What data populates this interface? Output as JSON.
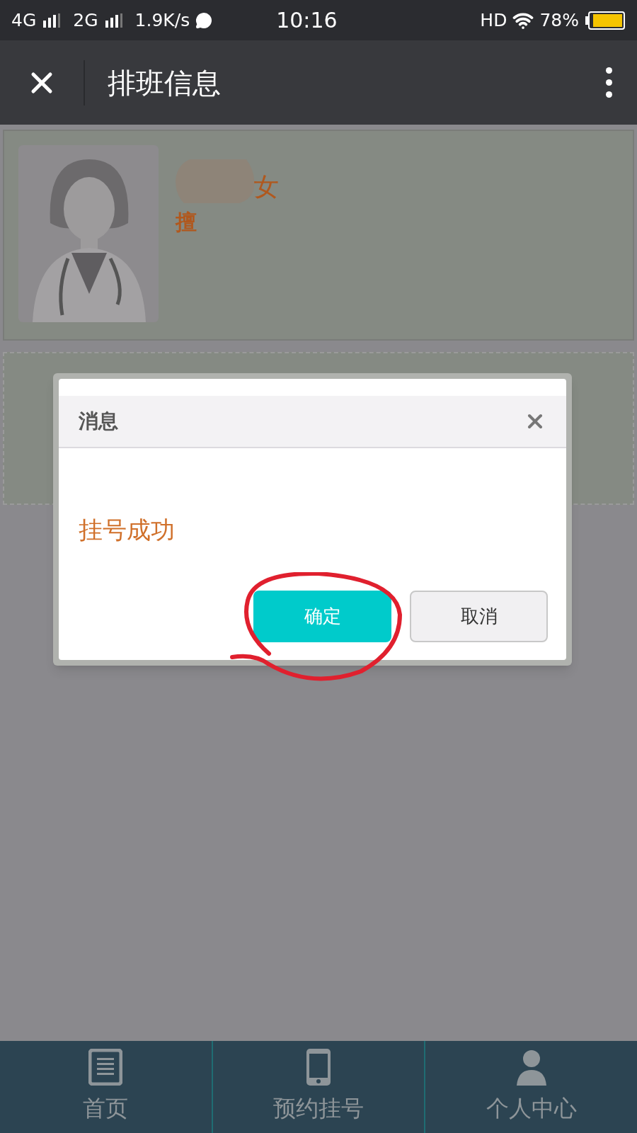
{
  "status_bar": {
    "network_1": "4G",
    "network_2": "2G",
    "speed": "1.9K/s",
    "time": "10:16",
    "hd": "HD",
    "battery": "78%"
  },
  "nav_bar": {
    "title": "排班信息"
  },
  "doctor_card": {
    "gender": "女",
    "specialty": "擅"
  },
  "dialog": {
    "title": "消息",
    "message": "挂号成功",
    "buttons": [
      {
        "label": "确定",
        "kind": "primary"
      },
      {
        "label": "取消",
        "kind": "secondary"
      }
    ]
  },
  "tab_bar": {
    "items": [
      {
        "label": "首页",
        "kind": "document"
      },
      {
        "label": "预约挂号",
        "kind": "phone"
      },
      {
        "label": "个人中心",
        "kind": "person"
      }
    ]
  }
}
